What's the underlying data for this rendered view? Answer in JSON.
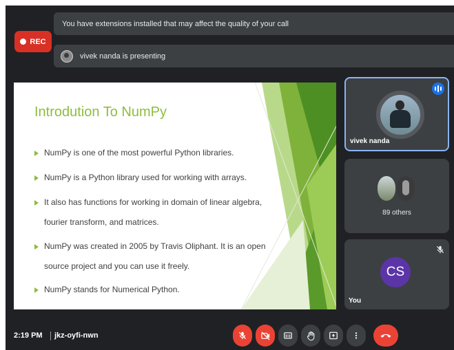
{
  "recording": {
    "label": "REC"
  },
  "banners": {
    "extensions_warning": "You have extensions installed that may affect the quality of your call",
    "presenting": "vivek nanda is presenting"
  },
  "slide": {
    "title": "Introdution To NumPy",
    "bullets": [
      "NumPy is one of the most powerful Python libraries.",
      "NumPy is a Python library used for working with arrays.",
      "It also has functions for working in domain of linear algebra, fourier transform, and matrices.",
      "NumPy was created in 2005 by Travis Oliphant. It is an open source project and you can use it freely.",
      "NumPy stands for Numerical Python."
    ],
    "accent_color": "#8cbe3c"
  },
  "participants": {
    "presenter_name": "vivek nanda",
    "others_count": "89 others",
    "self_label": "You",
    "self_initials": "CS",
    "self_color": "#5b35a8",
    "speaking_color": "#1a73e8"
  },
  "meeting": {
    "time": "2:19 PM",
    "separator": "|",
    "code": "jkz-oyfi-nwn"
  },
  "controls": [
    {
      "name": "microphone-off-icon",
      "state": "off"
    },
    {
      "name": "camera-off-icon",
      "state": "off"
    },
    {
      "name": "captions-icon"
    },
    {
      "name": "raise-hand-icon"
    },
    {
      "name": "present-icon"
    },
    {
      "name": "more-options-icon"
    },
    {
      "name": "end-call-icon"
    }
  ]
}
